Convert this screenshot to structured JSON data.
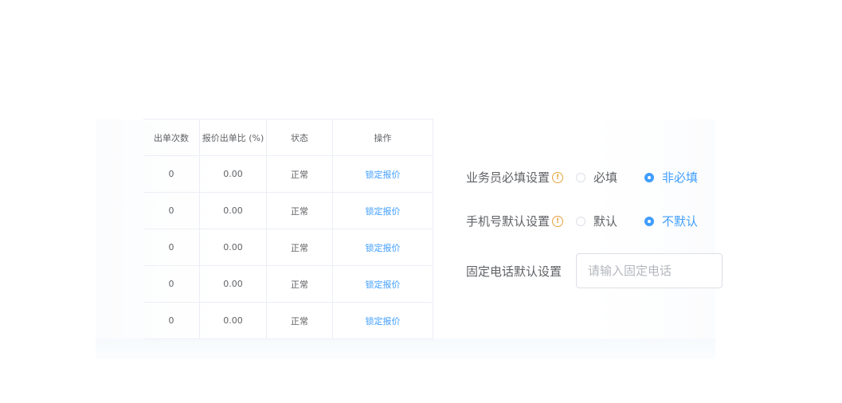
{
  "table": {
    "headers": [
      "出单次数",
      "报价出单比 (%)",
      "状态",
      "操作"
    ],
    "rows": [
      {
        "count": "0",
        "ratio": "0.00",
        "status": "正常",
        "action": "锁定报价"
      },
      {
        "count": "0",
        "ratio": "0.00",
        "status": "正常",
        "action": "锁定报价"
      },
      {
        "count": "0",
        "ratio": "0.00",
        "status": "正常",
        "action": "锁定报价"
      },
      {
        "count": "0",
        "ratio": "0.00",
        "status": "正常",
        "action": "锁定报价"
      },
      {
        "count": "0",
        "ratio": "0.00",
        "status": "正常",
        "action": "锁定报价"
      }
    ]
  },
  "form": {
    "salesman_required": {
      "label": "业务员必填设置",
      "warn_icon": "!",
      "options": [
        "必填",
        "非必填"
      ],
      "selected": "非必填"
    },
    "phone_default": {
      "label": "手机号默认设置",
      "warn_icon": "!",
      "options": [
        "默认",
        "不默认"
      ],
      "selected": "不默认"
    },
    "landline_default": {
      "label": "固定电话默认设置",
      "value": "",
      "placeholder": "请输入固定电话"
    }
  },
  "colors": {
    "primary": "#409eff",
    "warning": "#e6a23c",
    "text": "#606266",
    "border": "#ebeef5"
  }
}
